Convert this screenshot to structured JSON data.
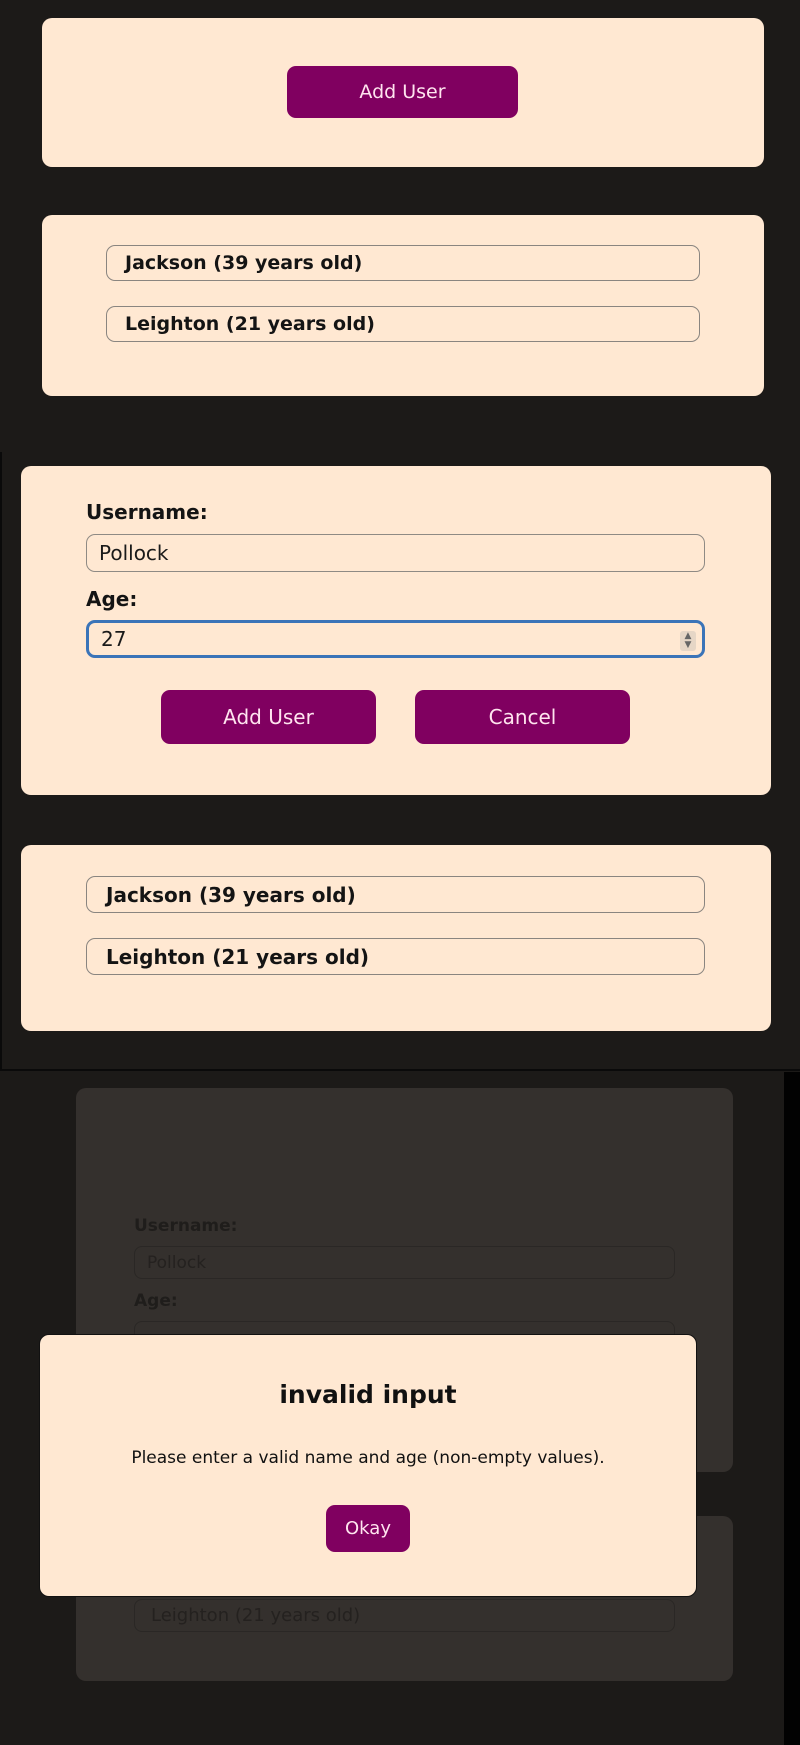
{
  "section1": {
    "add_user_label": "Add User",
    "users": [
      "Jackson (39 years old)",
      "Leighton (21 years old)"
    ]
  },
  "section2": {
    "username_label": "Username:",
    "username_value": "Pollock",
    "age_label": "Age:",
    "age_value": "27",
    "add_user_label": "Add User",
    "cancel_label": "Cancel",
    "users": [
      "Jackson (39 years old)",
      "Leighton (21 years old)"
    ]
  },
  "section3": {
    "username_label": "Username:",
    "username_value": "Pollock",
    "age_label": "Age:",
    "visible_user": "Leighton (21 years old)",
    "modal": {
      "title": "invalid input",
      "message": "Please enter a valid name and age (non-empty values).",
      "okay_label": "Okay"
    }
  },
  "colors": {
    "card_bg": "#ffe8d2",
    "accent": "#800060",
    "page_bg": "#1c1a18",
    "focus": "#3b74b8"
  }
}
